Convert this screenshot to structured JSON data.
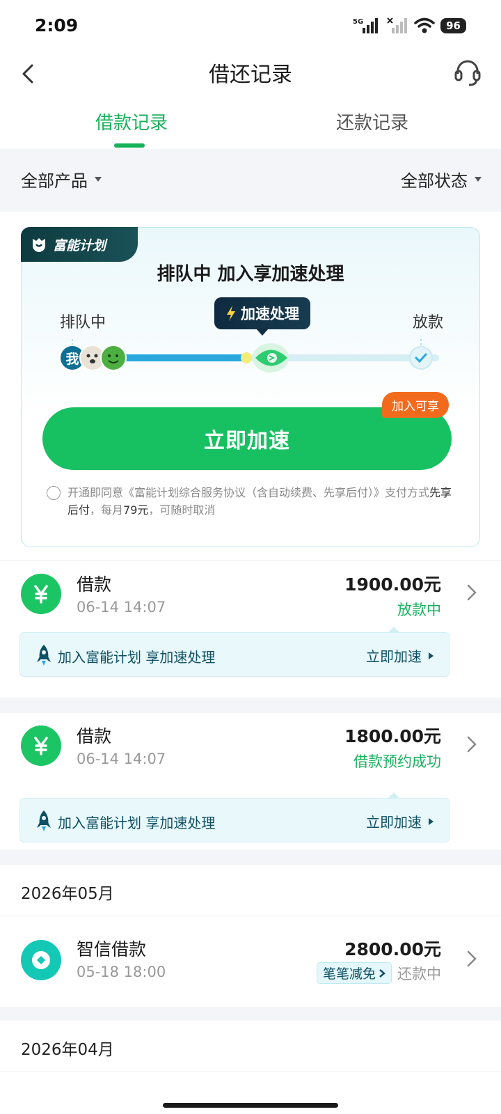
{
  "status": {
    "time": "2:09",
    "network": "5G",
    "battery": "96"
  },
  "nav": {
    "title": "借还记录",
    "back_icon": "chevron-left-icon",
    "support_icon": "headset-icon"
  },
  "tabs": [
    {
      "label": "借款记录",
      "active": true
    },
    {
      "label": "还款记录",
      "active": false
    }
  ],
  "filters": {
    "product": "全部产品",
    "status": "全部状态"
  },
  "promo": {
    "badge": "富能计划",
    "title": "排队中 加入享加速处理",
    "label_queue": "排队中",
    "label_accel": "加速处理",
    "label_release": "放款",
    "avatar_me": "我",
    "cta": "立即加速",
    "cta_tag": "加入可享",
    "agree_prefix": "开通即同意《富能计划综合服务协议（含自动续费、先享后付）》支付方式",
    "agree_highlight1": "先享后付",
    "agree_mid": "，每月",
    "agree_highlight2": "79元",
    "agree_suffix": "，可随时取消"
  },
  "records": [
    {
      "title": "借款",
      "date": "06-14 14:07",
      "amount": "1900.00元",
      "status": "放款中",
      "banner_text": "加入富能计划 享加速处理",
      "banner_action": "立即加速"
    },
    {
      "title": "借款",
      "date": "06-14 14:07",
      "amount": "1800.00元",
      "status": "借款预约成功",
      "banner_text": "加入富能计划 享加速处理",
      "banner_action": "立即加速"
    }
  ],
  "months": [
    {
      "label": "2026年05月"
    },
    {
      "label": "2026年04月"
    }
  ],
  "may_record": {
    "title": "智信借款",
    "date": "05-18 18:00",
    "amount": "2800.00元",
    "tag": "笔笔减免",
    "status": "还款中"
  },
  "colors": {
    "accent": "#16b25a",
    "cta": "#17c161",
    "tag_orange": "#f26b1d",
    "banner_text": "#0f5064"
  }
}
